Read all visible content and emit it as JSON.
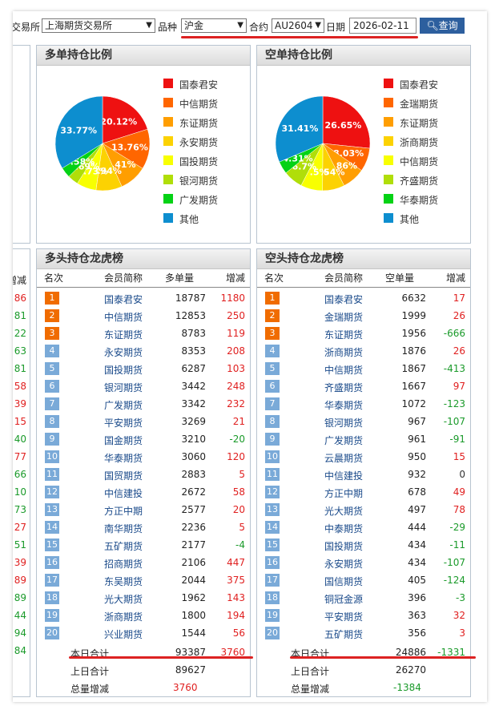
{
  "filters": {
    "exchange_label": "交易所",
    "exchange_value": "上海期货交易所",
    "variety_label": "品种",
    "variety_value": "沪金",
    "contract_label": "合约",
    "contract_value": "AU2604",
    "date_label": "日期",
    "date_value": "2026-02-11",
    "query_label": "查询"
  },
  "long_pie": {
    "title": "多单持仓比例",
    "slices": [
      {
        "name": "国泰君安",
        "pct": 20.12,
        "label": "20.12%",
        "color": "#ee1111"
      },
      {
        "name": "中信期货",
        "pct": 13.76,
        "label": "13.76%",
        "color": "#ff6600"
      },
      {
        "name": "东证期货",
        "pct": 9.41,
        "label": "9.41%",
        "color": "#ff9e01"
      },
      {
        "name": "永安期货",
        "pct": 8.94,
        "label": "8.94%",
        "color": "#fcd202"
      },
      {
        "name": "国投期货",
        "pct": 6.73,
        "label": "6.73%",
        "color": "#f8ff01"
      },
      {
        "name": "银河期货",
        "pct": 3.69,
        "label": "3.69%",
        "color": "#b0de09"
      },
      {
        "name": "广发期货",
        "pct": 3.58,
        "label": "3.58%",
        "color": "#04d215"
      },
      {
        "name": "其他",
        "pct": 33.77,
        "label": "33.77%",
        "color": "#0d8ecf"
      }
    ]
  },
  "short_pie": {
    "title": "空单持仓比例",
    "slices": [
      {
        "name": "国泰君安",
        "pct": 26.65,
        "label": "26.65%",
        "color": "#ee1111"
      },
      {
        "name": "金瑞期货",
        "pct": 8.03,
        "label": "8.03%",
        "color": "#ff6600"
      },
      {
        "name": "东证期货",
        "pct": 7.86,
        "label": "7.86%",
        "color": "#ff9e01"
      },
      {
        "name": "浙商期货",
        "pct": 7.54,
        "label": "7.54%",
        "color": "#fcd202"
      },
      {
        "name": "中信期货",
        "pct": 7.5,
        "label": "7.5%",
        "color": "#f8ff01"
      },
      {
        "name": "齐盛期货",
        "pct": 6.7,
        "label": "6.7%",
        "color": "#b0de09"
      },
      {
        "name": "华泰期货",
        "pct": 4.31,
        "label": "4.31%",
        "color": "#04d215"
      },
      {
        "name": "其他",
        "pct": 31.41,
        "label": "31.41%",
        "color": "#0d8ecf"
      }
    ]
  },
  "long_table": {
    "title": "多头持仓龙虎榜",
    "headers": {
      "rank": "名次",
      "member": "会员简称",
      "qty": "多单量",
      "chg": "增减"
    },
    "rows": [
      {
        "rank": "1",
        "member": "国泰君安",
        "qty": "18787",
        "chg": "1180"
      },
      {
        "rank": "2",
        "member": "中信期货",
        "qty": "12853",
        "chg": "250"
      },
      {
        "rank": "3",
        "member": "东证期货",
        "qty": "8783",
        "chg": "119"
      },
      {
        "rank": "4",
        "member": "永安期货",
        "qty": "8353",
        "chg": "208"
      },
      {
        "rank": "5",
        "member": "国投期货",
        "qty": "6287",
        "chg": "103"
      },
      {
        "rank": "6",
        "member": "银河期货",
        "qty": "3442",
        "chg": "248"
      },
      {
        "rank": "7",
        "member": "广发期货",
        "qty": "3342",
        "chg": "232"
      },
      {
        "rank": "8",
        "member": "平安期货",
        "qty": "3269",
        "chg": "21"
      },
      {
        "rank": "9",
        "member": "国金期货",
        "qty": "3210",
        "chg": "-20"
      },
      {
        "rank": "10",
        "member": "华泰期货",
        "qty": "3060",
        "chg": "120"
      },
      {
        "rank": "11",
        "member": "国贸期货",
        "qty": "2883",
        "chg": "5"
      },
      {
        "rank": "12",
        "member": "中信建投",
        "qty": "2672",
        "chg": "58"
      },
      {
        "rank": "13",
        "member": "方正中期",
        "qty": "2577",
        "chg": "20"
      },
      {
        "rank": "14",
        "member": "南华期货",
        "qty": "2236",
        "chg": "5"
      },
      {
        "rank": "15",
        "member": "五矿期货",
        "qty": "2177",
        "chg": "-4"
      },
      {
        "rank": "16",
        "member": "招商期货",
        "qty": "2106",
        "chg": "447"
      },
      {
        "rank": "17",
        "member": "东吴期货",
        "qty": "2044",
        "chg": "375"
      },
      {
        "rank": "18",
        "member": "光大期货",
        "qty": "1962",
        "chg": "143"
      },
      {
        "rank": "19",
        "member": "浙商期货",
        "qty": "1800",
        "chg": "194"
      },
      {
        "rank": "20",
        "member": "兴业期货",
        "qty": "1544",
        "chg": "56"
      }
    ],
    "today_label": "本日合计",
    "today_qty": "93387",
    "today_chg": "3760",
    "prev_label": "上日合计",
    "prev_qty": "89627",
    "total_label": "总量增减",
    "total_chg": "3760"
  },
  "short_table": {
    "title": "空头持仓龙虎榜",
    "headers": {
      "rank": "名次",
      "member": "会员简称",
      "qty": "空单量",
      "chg": "增减"
    },
    "rows": [
      {
        "rank": "1",
        "member": "国泰君安",
        "qty": "6632",
        "chg": "17"
      },
      {
        "rank": "2",
        "member": "金瑞期货",
        "qty": "1999",
        "chg": "26"
      },
      {
        "rank": "3",
        "member": "东证期货",
        "qty": "1956",
        "chg": "-666"
      },
      {
        "rank": "4",
        "member": "浙商期货",
        "qty": "1876",
        "chg": "26"
      },
      {
        "rank": "5",
        "member": "中信期货",
        "qty": "1867",
        "chg": "-413"
      },
      {
        "rank": "6",
        "member": "齐盛期货",
        "qty": "1667",
        "chg": "97"
      },
      {
        "rank": "7",
        "member": "华泰期货",
        "qty": "1072",
        "chg": "-123"
      },
      {
        "rank": "8",
        "member": "银河期货",
        "qty": "967",
        "chg": "-107"
      },
      {
        "rank": "9",
        "member": "广发期货",
        "qty": "961",
        "chg": "-91"
      },
      {
        "rank": "10",
        "member": "云晨期货",
        "qty": "950",
        "chg": "15"
      },
      {
        "rank": "11",
        "member": "中信建投",
        "qty": "932",
        "chg": "0"
      },
      {
        "rank": "12",
        "member": "方正中期",
        "qty": "678",
        "chg": "49"
      },
      {
        "rank": "13",
        "member": "光大期货",
        "qty": "497",
        "chg": "78"
      },
      {
        "rank": "14",
        "member": "中泰期货",
        "qty": "444",
        "chg": "-29"
      },
      {
        "rank": "15",
        "member": "国投期货",
        "qty": "434",
        "chg": "-11"
      },
      {
        "rank": "16",
        "member": "永安期货",
        "qty": "434",
        "chg": "-107"
      },
      {
        "rank": "17",
        "member": "国信期货",
        "qty": "405",
        "chg": "-124"
      },
      {
        "rank": "18",
        "member": "铜冠金源",
        "qty": "396",
        "chg": "-3"
      },
      {
        "rank": "19",
        "member": "平安期货",
        "qty": "363",
        "chg": "32"
      },
      {
        "rank": "20",
        "member": "五矿期货",
        "qty": "356",
        "chg": "3"
      }
    ],
    "today_label": "本日合计",
    "today_qty": "24886",
    "today_chg": "-1331",
    "prev_label": "上日合计",
    "prev_qty": "26270",
    "total_label": "总量增减",
    "total_chg": "-1384"
  },
  "left_strip": {
    "header": "增减",
    "values": [
      "86",
      "81",
      "22",
      "63",
      "81",
      "58",
      "39",
      "15",
      "40",
      "77",
      "66",
      "10",
      "73",
      "27",
      "51",
      "39",
      "89",
      "89",
      "44",
      "94",
      "84"
    ],
    "signs": [
      "pos",
      "neg",
      "neg",
      "neg",
      "neg",
      "pos",
      "pos",
      "pos",
      "neg",
      "pos",
      "neg",
      "neg",
      "neg",
      "pos",
      "neg",
      "pos",
      "pos",
      "neg",
      "neg",
      "neg",
      "neg"
    ]
  },
  "colors": {
    "rank_top": "#f06c00",
    "rank_other": "#7aaad8",
    "positive": "#e02020",
    "negative": "#1a9a2a",
    "annotation": "#d22222"
  }
}
